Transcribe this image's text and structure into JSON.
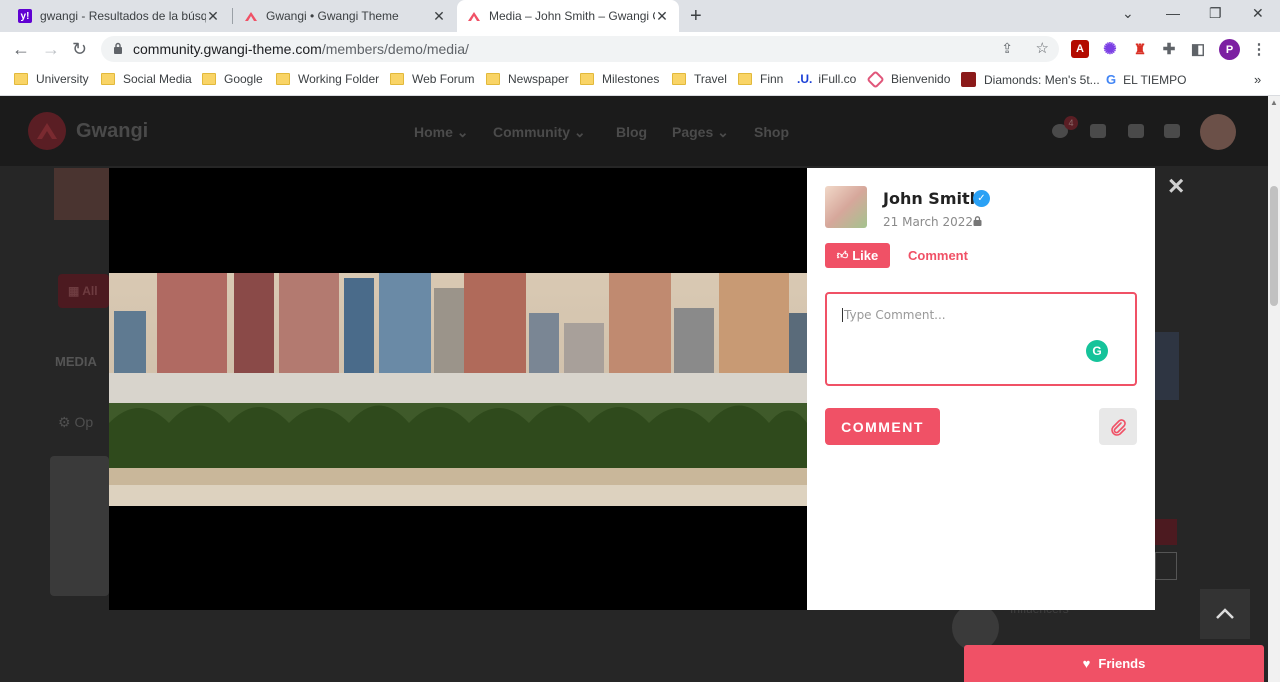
{
  "browser": {
    "tabs": [
      {
        "title": "gwangi - Resultados de la búsque",
        "icon": "yahoo-icon",
        "active": false
      },
      {
        "title": "Gwangi • Gwangi Theme",
        "icon": "gwangi-icon",
        "active": false
      },
      {
        "title": "Media – John Smith – Gwangi Co",
        "icon": "gwangi-icon",
        "active": true
      }
    ],
    "new_tab": "+",
    "url": {
      "host": "community.gwangi-theme.com",
      "path": "/members/demo/media/"
    },
    "bookmarks": [
      {
        "label": "University",
        "icon": "folder-icon"
      },
      {
        "label": "Social Media",
        "icon": "folder-icon"
      },
      {
        "label": "Google",
        "icon": "folder-icon"
      },
      {
        "label": "Working Folder",
        "icon": "folder-icon"
      },
      {
        "label": "Web Forum",
        "icon": "folder-icon"
      },
      {
        "label": "Newspaper",
        "icon": "folder-icon"
      },
      {
        "label": "Milestones",
        "icon": "folder-icon"
      },
      {
        "label": "Travel",
        "icon": "folder-icon"
      },
      {
        "label": "Finn",
        "icon": "folder-icon"
      },
      {
        "label": "iFull.co",
        "icon": "ifull-icon"
      },
      {
        "label": "Bienvenido",
        "icon": "bienvenido-icon"
      },
      {
        "label": "Diamonds: Men's 5t...",
        "icon": "diamonds-icon"
      },
      {
        "label": "EL TIEMPO",
        "icon": "google-icon"
      }
    ],
    "profile_initial": "P",
    "more_bookmarks": "»"
  },
  "site": {
    "logo_text": "Gwangi",
    "menu": [
      "Home",
      "Community",
      "Blog",
      "Pages",
      "Shop"
    ],
    "notification_count": "4",
    "bg_media_label": "MEDIA",
    "bg_all_label": "All",
    "bg_option_label": "Op",
    "bg_influencers": "Influencers"
  },
  "modal": {
    "author_name": "John Smith",
    "date": "21 March 2022",
    "like_label": "Like",
    "comment_link": "Comment",
    "comment_placeholder": "Type Comment...",
    "submit_label": "COMMENT",
    "close_label": "×"
  },
  "friends_bar": {
    "label": "Friends"
  },
  "colors": {
    "accent": "#f05166",
    "verified": "#2aa1f5",
    "grammarly": "#15c39a"
  }
}
